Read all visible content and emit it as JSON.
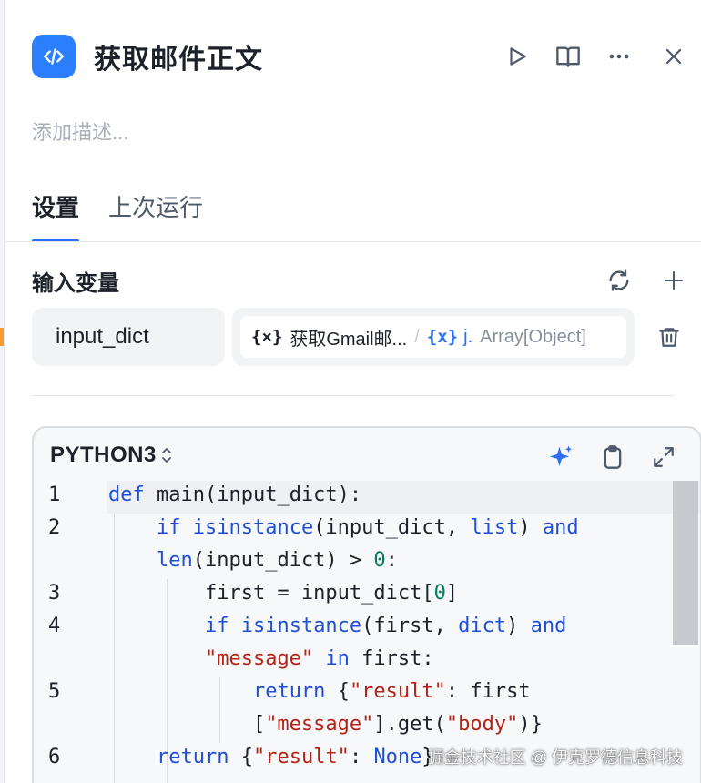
{
  "header": {
    "title": "获取邮件正文",
    "node_icon": "code-icon",
    "actions": [
      "run-icon",
      "docs-book-icon",
      "more-icon",
      "close-icon"
    ]
  },
  "description": {
    "placeholder": "添加描述..."
  },
  "tabs": [
    {
      "label": "设置",
      "active": true
    },
    {
      "label": "上次运行",
      "active": false
    }
  ],
  "input_section": {
    "title": "输入变量",
    "variables": [
      {
        "name": "input_dict",
        "ref_icon": "{×}",
        "ref_node": "获取Gmail邮...",
        "ref_sep": "/",
        "ref_var_icon": "{x}",
        "ref_var": "j.",
        "ref_type": "Array[Object]"
      }
    ]
  },
  "code_editor": {
    "language": "PYTHON3",
    "line_numbers": [
      "1",
      "2",
      "3",
      "4",
      "5",
      "6"
    ]
  },
  "watermark": "掘金技术社区 @ 伊克罗德信息科技",
  "colors": {
    "accent": "#2b6ff6",
    "node_icon_bg": "#2b7fff",
    "keyword": "#1f4fd6",
    "string": "#b42318",
    "number": "#0b7a5c"
  }
}
